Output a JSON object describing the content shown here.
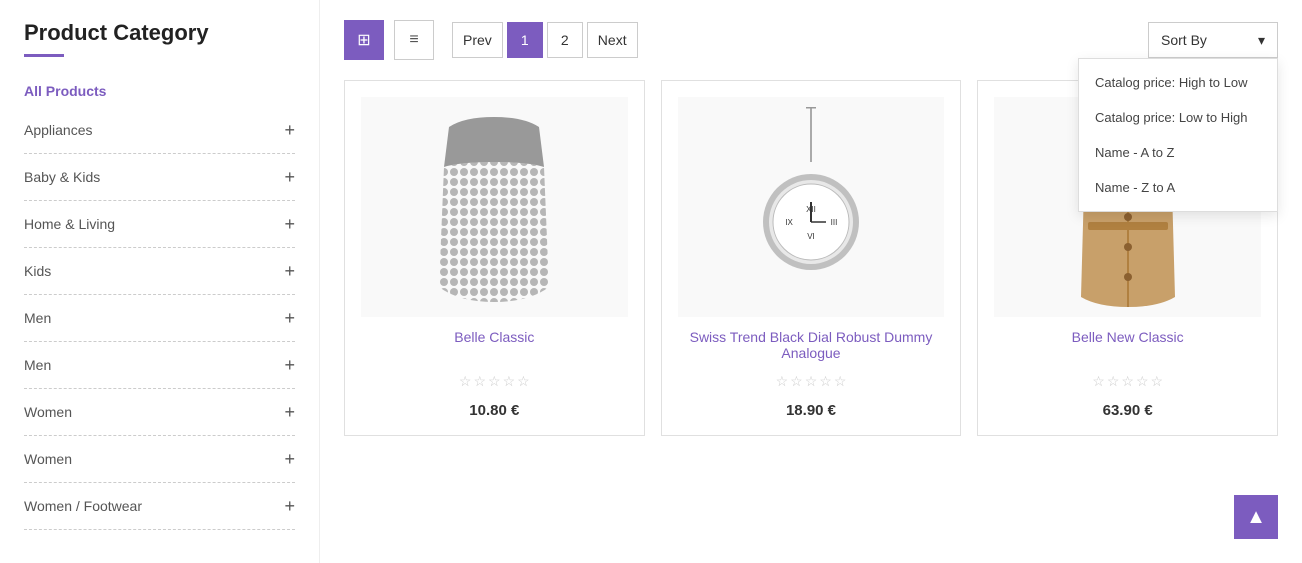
{
  "sidebar": {
    "title": "Product Category",
    "all_products_label": "All Products",
    "items": [
      {
        "label": "Appliances",
        "has_expand": true
      },
      {
        "label": "Baby & Kids",
        "has_expand": true
      },
      {
        "label": "Home & Living",
        "has_expand": true
      },
      {
        "label": "Kids",
        "has_expand": true
      },
      {
        "label": "Men",
        "has_expand": true
      },
      {
        "label": "Men",
        "has_expand": true
      },
      {
        "label": "Women",
        "has_expand": true
      },
      {
        "label": "Women",
        "has_expand": true
      },
      {
        "label": "Women / Footwear",
        "has_expand": true
      }
    ]
  },
  "toolbar": {
    "view_grid_label": "⊞",
    "view_list_label": "≡",
    "prev_label": "Prev",
    "page1_label": "1",
    "page2_label": "2",
    "next_label": "Next",
    "sort_label": "Sort By"
  },
  "sort_dropdown": {
    "options": [
      "Catalog price: High to Low",
      "Catalog price: Low to High",
      "Name - A to Z",
      "Name - Z to A"
    ]
  },
  "products": [
    {
      "name": "Belle Classic",
      "price": "10.80 €",
      "stars": [
        0,
        0,
        0,
        0,
        0
      ],
      "type": "dress"
    },
    {
      "name": "Swiss Trend Black Dial Robust Dummy Analogue",
      "price": "18.90 €",
      "stars": [
        0,
        0,
        0,
        0,
        0
      ],
      "type": "watch"
    },
    {
      "name": "Belle New Classic",
      "price": "63.90 €",
      "stars": [
        0,
        0,
        0,
        0,
        0
      ],
      "type": "coat"
    }
  ],
  "scroll_top_icon": "▲",
  "accent_color": "#7c5cbf"
}
